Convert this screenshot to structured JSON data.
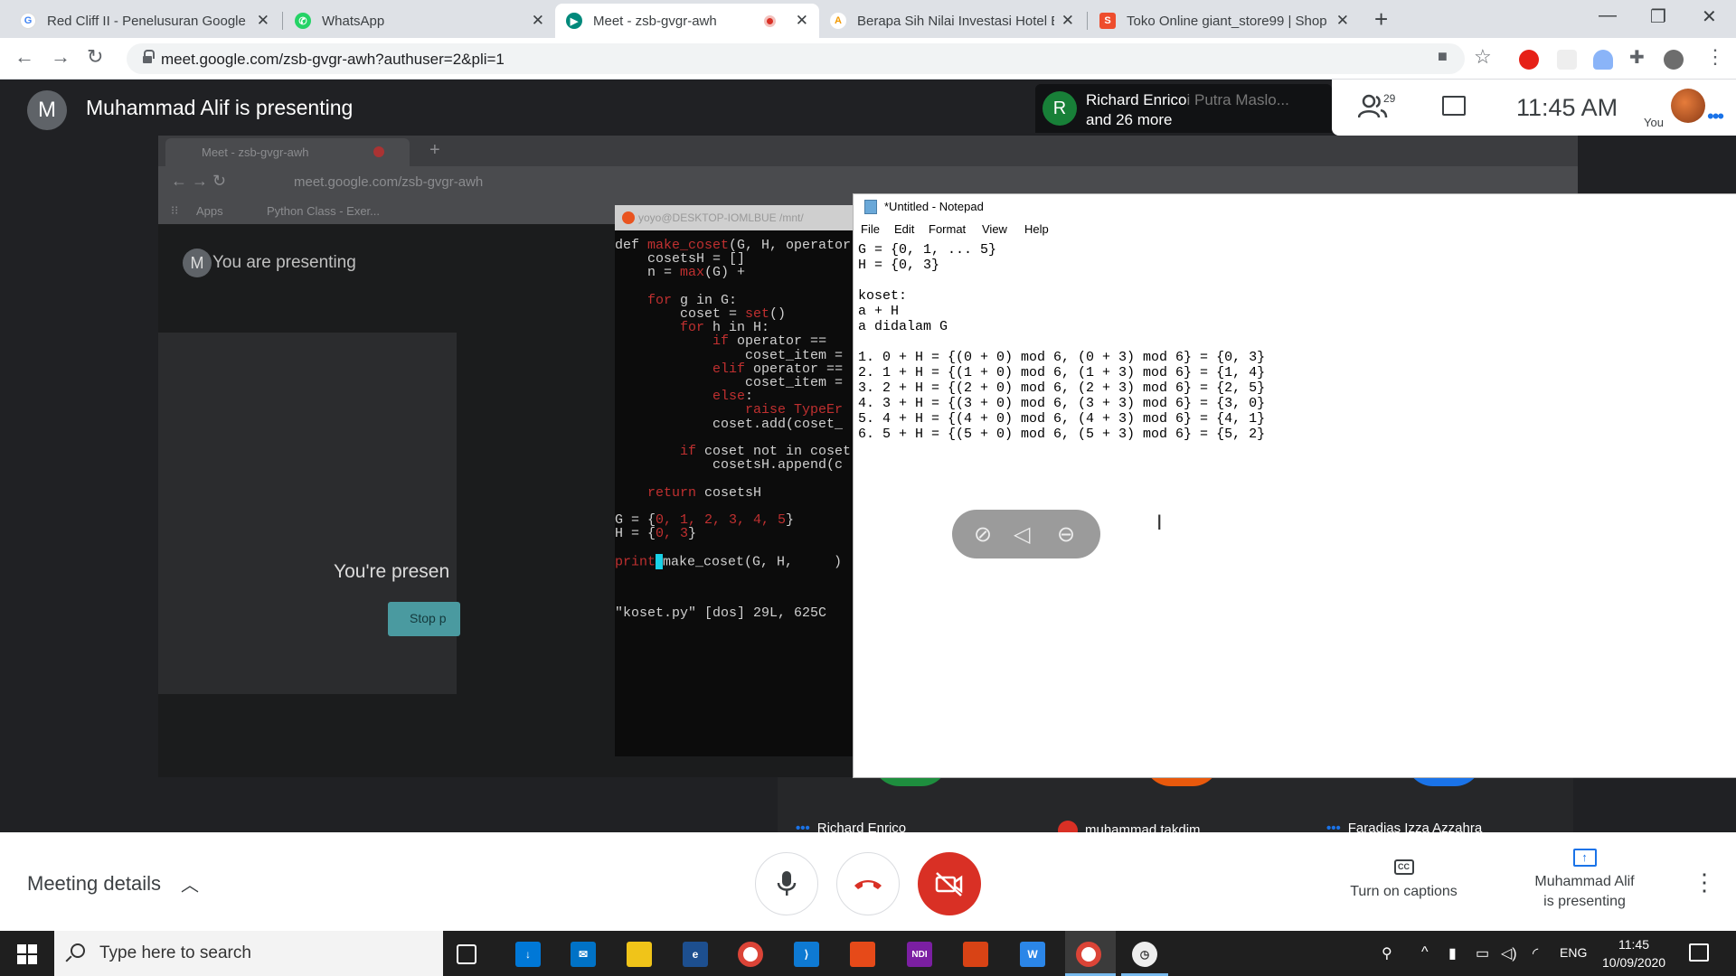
{
  "browser": {
    "tabs": [
      {
        "title": "Red Cliff II - Penelusuran Google",
        "favicon": "google-g-icon",
        "active": false
      },
      {
        "title": "WhatsApp",
        "favicon": "whatsapp-icon",
        "active": false
      },
      {
        "title": "Meet - zsb-gvgr-awh",
        "favicon": "meet-icon",
        "active": true,
        "recording": true
      },
      {
        "title": "Berapa Sih Nilai Investasi Hotel B",
        "favicon": "page-a-icon",
        "active": false
      },
      {
        "title": "Toko Online giant_store99 | Shop",
        "favicon": "shopee-icon",
        "active": false
      }
    ],
    "url": "meet.google.com/zsb-gvgr-awh?authuser=2&pli=1"
  },
  "meet": {
    "presenter_initial": "M",
    "presenter_title": "Muhammad Alif is presenting",
    "participant_chip": {
      "initial": "R",
      "name": "Richard Enrico",
      "name_faded": "i Putra Maslo...",
      "more": "and 26 more"
    },
    "people_count": "29",
    "time": "11:45 AM",
    "you_label": "You",
    "tiles": [
      {
        "name": "Richard Enrico",
        "indicator": "dots"
      },
      {
        "name": "muhammad takdim",
        "indicator": "muted"
      },
      {
        "name": "Faradias Izza Azzahra",
        "indicator": "dots"
      }
    ],
    "bottom": {
      "meeting_details": "Meeting details",
      "captions_icon": "CC",
      "captions_label": "Turn on captions",
      "presenting_label_line1": "Muhammad Alif",
      "presenting_label_line2": "is presenting"
    }
  },
  "shared_screen": {
    "tab_title": "Meet - zsb-gvgr-awh",
    "url": "meet.google.com/zsb-gvgr-awh",
    "bookmarks": [
      "Apps",
      "Python Class - Exer..."
    ],
    "you_are_presenting": "You are presenting",
    "avatar_initial": "M",
    "youre_presenting_partial": "You're presen",
    "stop_partial": "Stop p",
    "terminal": {
      "title": "yoyo@DESKTOP-IOMLBUE /mnt/",
      "lines": [
        {
          "pre": "def ",
          "kw": "make_coset",
          "post": "(G, H, operator"
        },
        {
          "pre": "    cosetsH = []",
          "kw": "",
          "post": ""
        },
        {
          "pre": "    n = ",
          "kw": "max",
          "post": "(G) +"
        },
        {
          "pre": "",
          "kw": "",
          "post": ""
        },
        {
          "pre": "    ",
          "kw": "for",
          "post": " g in G:"
        },
        {
          "pre": "        coset = ",
          "kw": "set",
          "post": "()"
        },
        {
          "pre": "        ",
          "kw": "for",
          "post": " h in H:"
        },
        {
          "pre": "            ",
          "kw": "if",
          "post": " operator =="
        },
        {
          "pre": "                coset_item =",
          "kw": "",
          "post": ""
        },
        {
          "pre": "            ",
          "kw": "elif",
          "post": " operator =="
        },
        {
          "pre": "                coset_item =",
          "kw": "",
          "post": ""
        },
        {
          "pre": "            ",
          "kw": "else",
          "post": ":"
        },
        {
          "pre": "                ",
          "kw": "raise TypeEr",
          "post": ""
        },
        {
          "pre": "            coset.add(coset_",
          "kw": "",
          "post": ""
        },
        {
          "pre": "",
          "kw": "",
          "post": ""
        },
        {
          "pre": "        ",
          "kw": "if",
          "post": " coset not in coset"
        },
        {
          "pre": "            cosetsH.append(c",
          "kw": "",
          "post": ""
        },
        {
          "pre": "",
          "kw": "",
          "post": ""
        },
        {
          "pre": "    ",
          "kw": "return",
          "post": " cosetsH"
        },
        {
          "pre": "",
          "kw": "",
          "post": ""
        },
        {
          "pre": "G = {",
          "kw": "0, 1, 2, 3, 4, 5",
          "post": "}"
        },
        {
          "pre": "H = {",
          "kw": "0, 3",
          "post": "}"
        },
        {
          "pre": "",
          "kw": "",
          "post": ""
        },
        {
          "pre": "",
          "kw": "print",
          "post": "make_coset(G, H,     )"
        }
      ],
      "status": "\"koset.py\" [dos] 29L, 625C"
    },
    "notepad": {
      "title": "*Untitled - Notepad",
      "menu": [
        "File",
        "Edit",
        "Format",
        "View",
        "Help"
      ],
      "text": "G = {0, 1, ... 5}\nH = {0, 3}\n\nkoset:\na + H\na didalam G\n\n1. 0 + H = {(0 + 0) mod 6, (0 + 3) mod 6} = {0, 3}\n2. 1 + H = {(1 + 0) mod 6, (1 + 3) mod 6} = {1, 4}\n3. 2 + H = {(2 + 0) mod 6, (2 + 3) mod 6} = {2, 5}\n4. 3 + H = {(3 + 0) mod 6, (3 + 3) mod 6} = {3, 0}\n5. 4 + H = {(4 + 0) mod 6, (4 + 3) mod 6} = {4, 1}\n6. 5 + H = {(5 + 0) mod 6, (5 + 3) mod 6} = {5, 2}"
    }
  },
  "taskbar": {
    "search_placeholder": "Type here to search",
    "apps": [
      "task-view-icon",
      "installer-icon",
      "mail-icon",
      "file-explorer-icon",
      "app-blue-icon",
      "chrome-icon",
      "vscode-icon",
      "office-icon",
      "ndi-icon",
      "powerpoint-icon",
      "wps-icon",
      "chrome-active-icon",
      "clock-app-icon"
    ],
    "lang": "ENG",
    "time": "11:45",
    "date": "10/09/2020"
  },
  "colors": {
    "meet_dark": "#202124",
    "hangup_red": "#d93025",
    "accent_blue": "#1a73e8",
    "terminal_cursor": "#19d1e6"
  }
}
